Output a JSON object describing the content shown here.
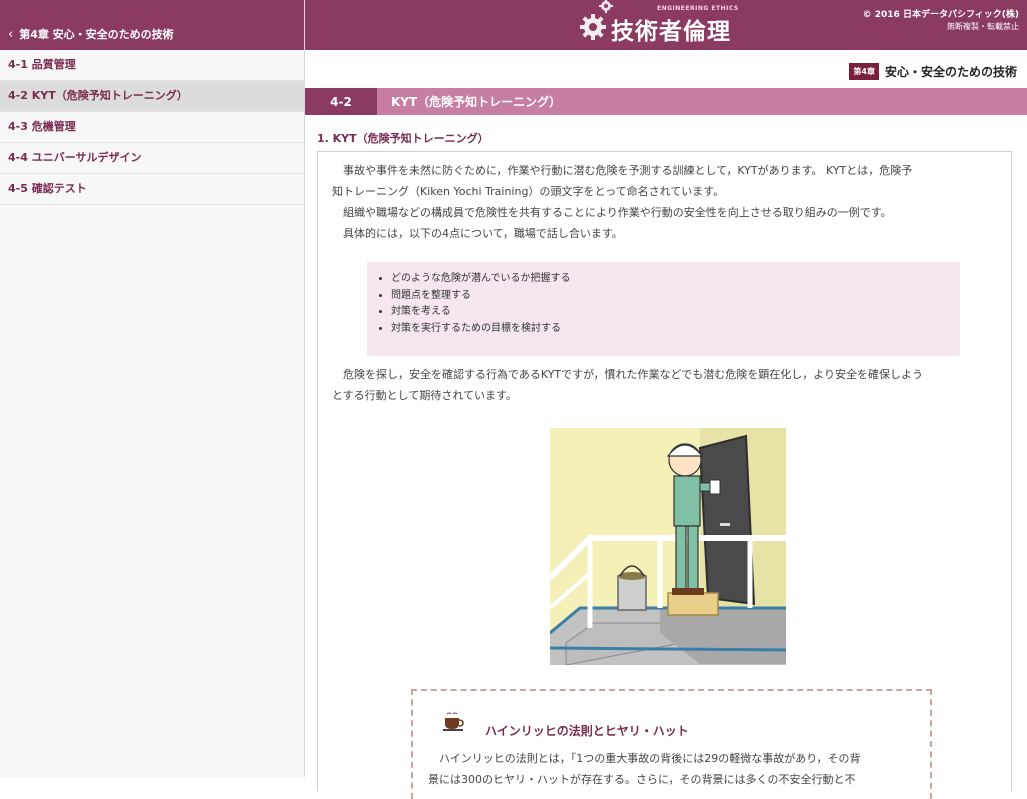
{
  "sidebar": {
    "header": "第4章 安心・安全のための技術",
    "items": [
      {
        "label": "4-1 品質管理"
      },
      {
        "label": "4-2 KYT（危険予知トレーニング）"
      },
      {
        "label": "4-3 危機管理"
      },
      {
        "label": "4-4 ユニバーサルデザイン"
      },
      {
        "label": "4-5 確認テスト"
      }
    ]
  },
  "topbar": {
    "logo_small": "ENGINEERING ETHICS",
    "logo_title": "技術者倫理",
    "copyright_line1": "© 2016 日本データパシフィック(株)",
    "copyright_line2": "無断複製・転載禁止"
  },
  "chapter": {
    "badge": "第4章",
    "title": "安心・安全のための技術"
  },
  "section": {
    "number": "4-2",
    "title": "KYT（危険予知トレーニング）"
  },
  "content": {
    "subheading": "1. KYT（危険予知トレーニング）",
    "para1_line1": "事故や事件を未然に防ぐために，作業や行動に潜む危険を予測する訓練として，KYTがあります。 KYTとは，危険予",
    "para1_line2": "知トレーニング（Kiken Yochi Training）の頭文字をとって命名されています。",
    "para2": "組織や職場などの構成員で危険性を共有することにより作業や行動の安全性を向上させる取り組みの一例です。",
    "para3": "具体的には，以下の4点について，職場で話し合います。",
    "bullets": [
      "どのような危険が潜んでいるか把握する",
      "問題点を整理する",
      "対策を考える",
      "対策を実行するための目標を検討する"
    ],
    "para4_line1": "危険を探し，安全を確認する行為であるKYTですが，慣れた作業などでも潜む危険を顕在化し，より安全を確保しよう",
    "para4_line2": "とする行動として期待されています。"
  },
  "note": {
    "title": "ハインリッヒの法則とヒヤリ・ハット",
    "text_line1": "ハインリッヒの法則とは，「1つの重大事故の背後には29の軽微な事故があり，その背",
    "text_line2": "景には300のヒヤリ・ハットが存在する。さらに，その背景には多くの不安全行動と不"
  },
  "colors": {
    "brand": "#8b3b60",
    "section_bar": "#c87ea1",
    "bullet_bg": "#f5e6ef"
  }
}
